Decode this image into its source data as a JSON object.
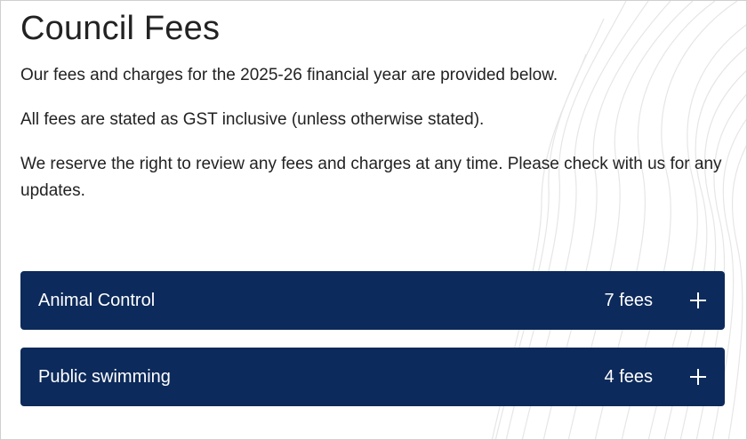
{
  "page": {
    "title": "Council Fees",
    "paragraphs": [
      "Our fees and charges for the 2025-26 financial year are provided below.",
      "All fees are stated as GST inclusive (unless otherwise stated).",
      "We reserve the right to review any fees and charges at any time. Please check with us for any updates."
    ]
  },
  "accordions": [
    {
      "title": "Animal Control",
      "count": "7 fees",
      "icon": "plus-icon"
    },
    {
      "title": "Public swimming",
      "count": "4 fees",
      "icon": "plus-icon"
    }
  ],
  "colors": {
    "accordion_bg": "#0c2a5b",
    "text": "#222222"
  }
}
